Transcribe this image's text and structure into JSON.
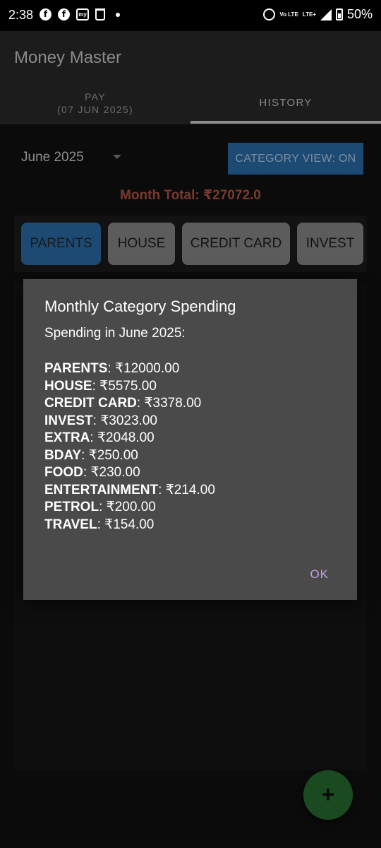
{
  "status_bar": {
    "time": "2:38",
    "lte_top": "Vo LTE",
    "lte_mid": "LTE+",
    "battery": "50%"
  },
  "app": {
    "title": "Money Master"
  },
  "tabs": {
    "pay_label": "PAY",
    "pay_date": "(07 JUN 2025)",
    "history_label": "HISTORY"
  },
  "filters": {
    "month": "June 2025",
    "category_view_button": "CATEGORY VIEW: ON",
    "month_total": "Month Total: ₹27072.0"
  },
  "categories": [
    {
      "label": "PARENTS",
      "active": true
    },
    {
      "label": "HOUSE",
      "active": false
    },
    {
      "label": "CREDIT CARD",
      "active": false
    },
    {
      "label": "INVEST",
      "active": false
    }
  ],
  "dialog": {
    "title": "Monthly Category Spending",
    "subtitle": "Spending in June 2025:",
    "items": [
      {
        "name": "PARENTS",
        "amount": "₹12000.00"
      },
      {
        "name": "HOUSE",
        "amount": "₹5575.00"
      },
      {
        "name": "CREDIT CARD",
        "amount": "₹3378.00"
      },
      {
        "name": "INVEST",
        "amount": "₹3023.00"
      },
      {
        "name": "EXTRA",
        "amount": "₹2048.00"
      },
      {
        "name": "BDAY",
        "amount": "₹250.00"
      },
      {
        "name": "FOOD",
        "amount": "₹230.00"
      },
      {
        "name": "ENTERTAINMENT",
        "amount": "₹214.00"
      },
      {
        "name": "PETROL",
        "amount": "₹200.00"
      },
      {
        "name": "TRAVEL",
        "amount": "₹154.00"
      }
    ],
    "ok_label": "OK"
  },
  "fab": {
    "icon": "plus-icon",
    "glyph": "+"
  },
  "colors": {
    "accent_blue": "#1d4a73",
    "total_red": "#7a3a2c",
    "ok_purple": "#c79cf0",
    "fab_green": "#1b4a21"
  }
}
